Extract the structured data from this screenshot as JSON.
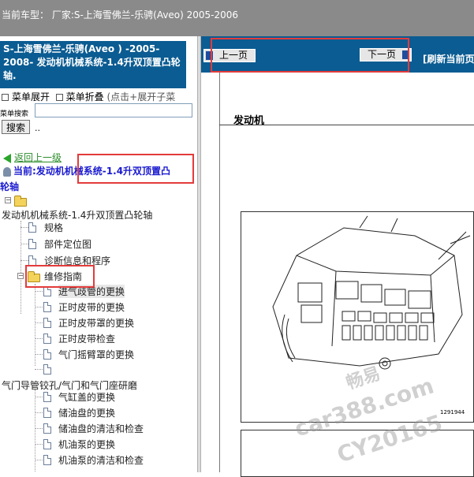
{
  "topbar": {
    "car_model": "当前车型： 厂家:S-上海雪佛兰-乐骋(Aveo) 2005-2006"
  },
  "left": {
    "title": "S-上海雪佛兰-乐骋(Aveo ) -2005-2008- 发动机机械系统-1.4升双顶置凸轮轴.",
    "menu_expand": "菜单展开",
    "menu_collapse": "菜单折叠",
    "menu_hint": "(点击+展开子菜",
    "search_label": "菜单搜索",
    "search_value": "",
    "search_button": "搜索",
    "dots": "..",
    "back_label": "返回上一级",
    "current_label": "当前:发动机机械系统-1.4升双顶置凸",
    "current_label_cont": "轮轴",
    "tree_root": "发动机机械系统-1.4升双顶置凸轮轴",
    "tree_items_l1": [
      "规格",
      "部件定位图",
      "诊断信息和程序"
    ],
    "tree_folder": "维修指南",
    "tree_items_l2": [
      "进气歧管的更换",
      "正时皮带的更换",
      "正时皮带罩的更换",
      "正时皮带检查",
      "气门摇臂罩的更换",
      ""
    ],
    "tree_root2": "气门导管铰孔/气门和气门座研磨",
    "tree_items_l3": [
      "气缸盖的更换",
      "储油盘的更换",
      "储油盘的清洁和检查",
      "机油泵的更换",
      "机油泵的清洁和检查"
    ]
  },
  "right": {
    "prev_button": "上一页",
    "next_button": "下一页",
    "refresh": "[刷新当前页",
    "section_title": "发动机",
    "figure_id": "1291944"
  },
  "watermark": {
    "line1": "畅易",
    "line2": "car388.com",
    "line3": "CY20165"
  },
  "colors": {
    "header_blue": "#0b5c92",
    "highlight_red": "#e33b3b",
    "topbar_gray": "#8a8a8a"
  }
}
